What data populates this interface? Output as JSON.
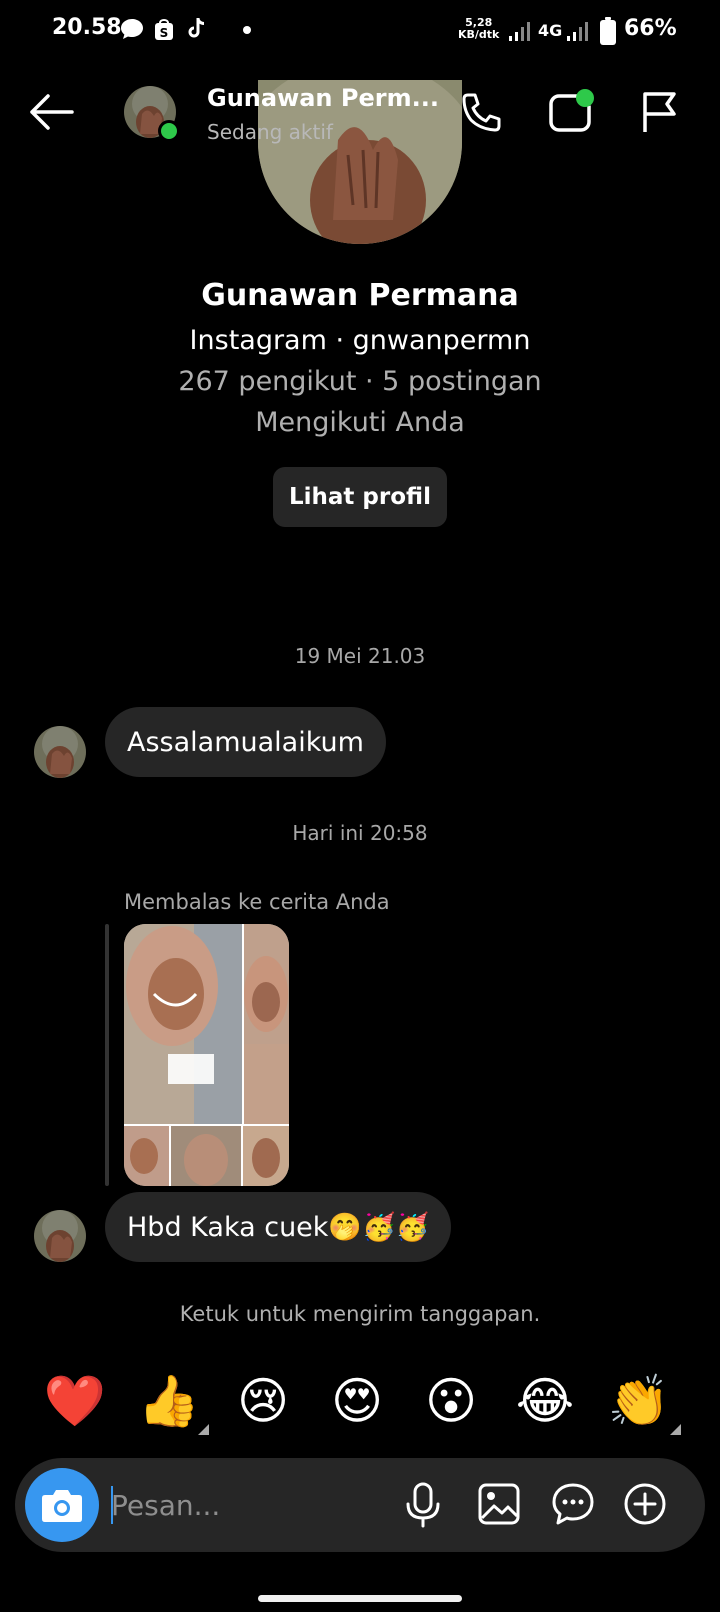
{
  "status_bar": {
    "time": "20.58",
    "speed_value": "5,28",
    "speed_unit": "KB/dtk",
    "network": "4G",
    "battery": "66%",
    "icons": [
      "chat-bubble-icon",
      "shopee-icon",
      "tiktok-icon",
      "dot-icon",
      "signal-icon",
      "battery-icon"
    ]
  },
  "header": {
    "name": "Gunawan Perm...",
    "status": "Sedang aktif",
    "online_color": "#2ec94a"
  },
  "profile": {
    "name": "Gunawan Permana",
    "platform_line": "Instagram · gnwanpermn",
    "stats_line": "267 pengikut · 5 postingan",
    "follow_line": "Mengikuti Anda",
    "view_button": "Lihat profil"
  },
  "thread": {
    "timestamp_1": "19 Mei 21.03",
    "message_1": "Assalamualaikum",
    "timestamp_2": "Hari ini 20:58",
    "reply_label": "Membalas ke cerita Anda",
    "message_2": "Hbd Kaka cuek🤭🥳🥳",
    "hint": "Ketuk untuk mengirim tanggapan."
  },
  "reactions": [
    "❤️",
    "👍",
    "😢",
    "😍",
    "😮",
    "😂",
    "👏"
  ],
  "composer": {
    "placeholder": "Pesan...",
    "accent": "#3797f0"
  }
}
